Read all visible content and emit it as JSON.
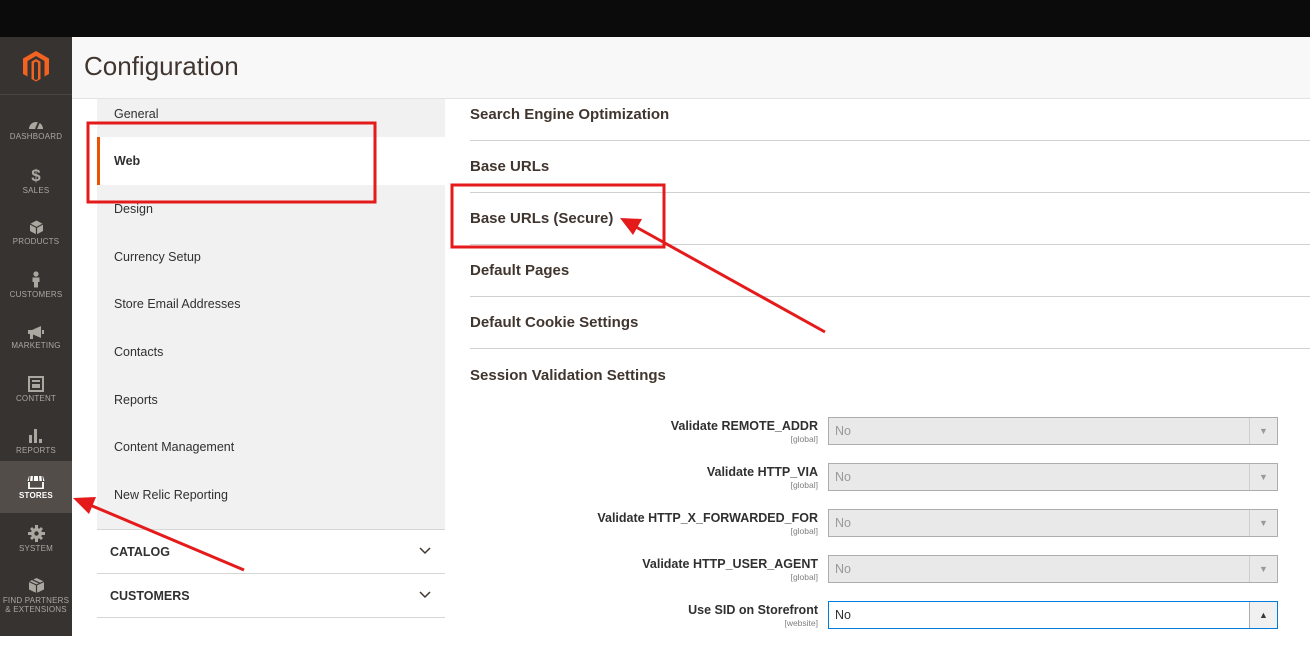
{
  "nav": {
    "items": [
      {
        "label": "DASHBOARD",
        "icon": "dashboard-icon"
      },
      {
        "label": "SALES",
        "icon": "dollar-icon"
      },
      {
        "label": "PRODUCTS",
        "icon": "cube-icon"
      },
      {
        "label": "CUSTOMERS",
        "icon": "person-icon"
      },
      {
        "label": "MARKETING",
        "icon": "megaphone-icon"
      },
      {
        "label": "CONTENT",
        "icon": "layout-icon"
      },
      {
        "label": "REPORTS",
        "icon": "bar-chart-icon"
      },
      {
        "label": "STORES",
        "icon": "store-icon",
        "active": true
      },
      {
        "label": "SYSTEM",
        "icon": "gear-icon"
      },
      {
        "label": "FIND PARTNERS & EXTENSIONS",
        "icon": "box-icon"
      }
    ]
  },
  "header": {
    "title": "Configuration"
  },
  "sidebar": {
    "items": [
      {
        "label": "General"
      },
      {
        "label": "Web",
        "active": true
      },
      {
        "label": "Design"
      },
      {
        "label": "Currency Setup"
      },
      {
        "label": "Store Email Addresses"
      },
      {
        "label": "Contacts"
      },
      {
        "label": "Reports"
      },
      {
        "label": "Content Management"
      },
      {
        "label": "New Relic Reporting"
      }
    ],
    "groups": [
      {
        "label": "CATALOG"
      },
      {
        "label": "CUSTOMERS"
      }
    ]
  },
  "sections": [
    {
      "label": "Search Engine Optimization"
    },
    {
      "label": "Base URLs"
    },
    {
      "label": "Base URLs (Secure)"
    },
    {
      "label": "Default Pages"
    },
    {
      "label": "Default Cookie Settings"
    },
    {
      "label": "Session Validation Settings"
    }
  ],
  "fields": [
    {
      "label": "Validate REMOTE_ADDR",
      "scope": "[global]",
      "value": "No",
      "disabled": true
    },
    {
      "label": "Validate HTTP_VIA",
      "scope": "[global]",
      "value": "No",
      "disabled": true
    },
    {
      "label": "Validate HTTP_X_FORWARDED_FOR",
      "scope": "[global]",
      "value": "No",
      "disabled": true
    },
    {
      "label": "Validate HTTP_USER_AGENT",
      "scope": "[global]",
      "value": "No",
      "disabled": true
    },
    {
      "label": "Use SID on Storefront",
      "scope": "[website]",
      "value": "No",
      "disabled": false
    }
  ],
  "colors": {
    "accent": "#eb5202",
    "annotation": "#e51b1b",
    "nav_bg": "#373330"
  }
}
